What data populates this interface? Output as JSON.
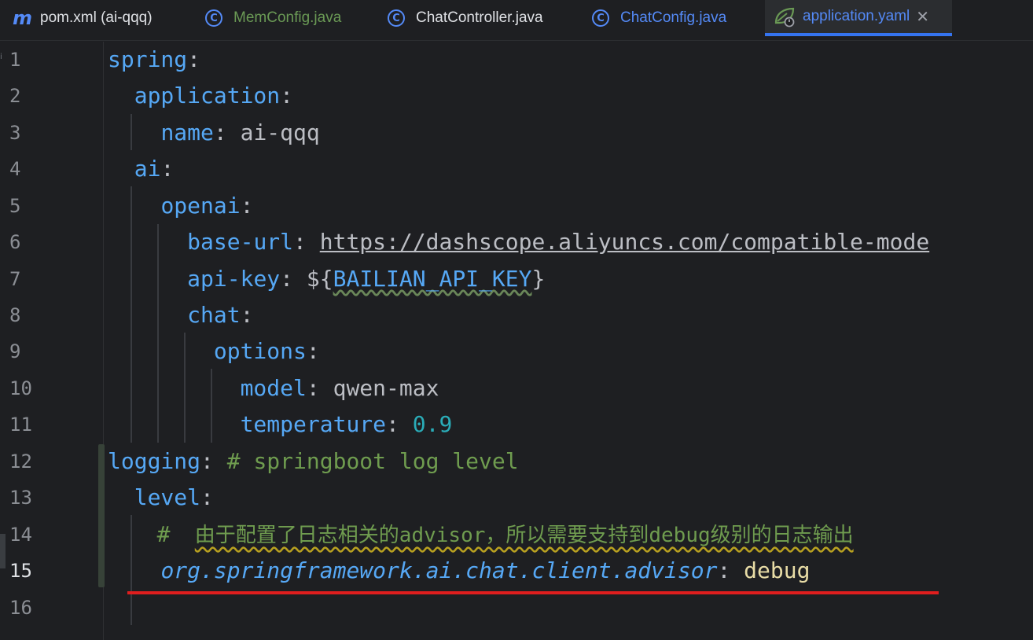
{
  "tabs": [
    {
      "label": "pom.xml (ai-qqq)",
      "icon": "maven-icon",
      "color": "#dfe1e5"
    },
    {
      "label": "MemConfig.java",
      "icon": "java-class-icon",
      "color": "#6a9955"
    },
    {
      "label": "ChatController.java",
      "icon": "java-class-icon",
      "color": "#dfe1e5"
    },
    {
      "label": "ChatConfig.java",
      "icon": "java-class-icon",
      "color": "#548af7"
    },
    {
      "label": "application.yaml",
      "icon": "spring-leaf-icon",
      "color": "#548af7",
      "active": true
    }
  ],
  "editor": {
    "gutter_mark": "i",
    "current_line": 15,
    "line_numbers": [
      "1",
      "2",
      "3",
      "4",
      "5",
      "6",
      "7",
      "8",
      "9",
      "10",
      "11",
      "12",
      "13",
      "14",
      "15",
      "16"
    ],
    "lines": {
      "l1_key": "spring",
      "l2_key": "application",
      "l3_key": "name",
      "l3_val": "ai-qqq",
      "l4_key": "ai",
      "l5_key": "openai",
      "l6_key": "base-url",
      "l6_val": "https://dashscope.aliyuncs.com/compatible-mode",
      "l7_key": "api-key",
      "l7_open": "${",
      "l7_ph": "BAILIAN_API_KEY",
      "l7_close": "}",
      "l8_key": "chat",
      "l9_key": "options",
      "l10_key": "model",
      "l10_val": "qwen-max",
      "l11_key": "temperature",
      "l11_val": "0.9",
      "l12_key": "logging",
      "l12_comment": "# springboot log level",
      "l13_key": "level",
      "l14_hash": "#",
      "l14_comment": "由于配置了日志相关的advisor，所以需要支持到debug级别的日志输出",
      "l15_key": "org.springframework.ai.chat.client.advisor",
      "l15_val": "debug",
      "colon": ":"
    }
  },
  "colors": {
    "key": "#56a8f5",
    "comment": "#6f9c4f",
    "number": "#2aacb8",
    "annotation_underline": "#e01e1e",
    "active_tab_indicator": "#3574f0"
  }
}
